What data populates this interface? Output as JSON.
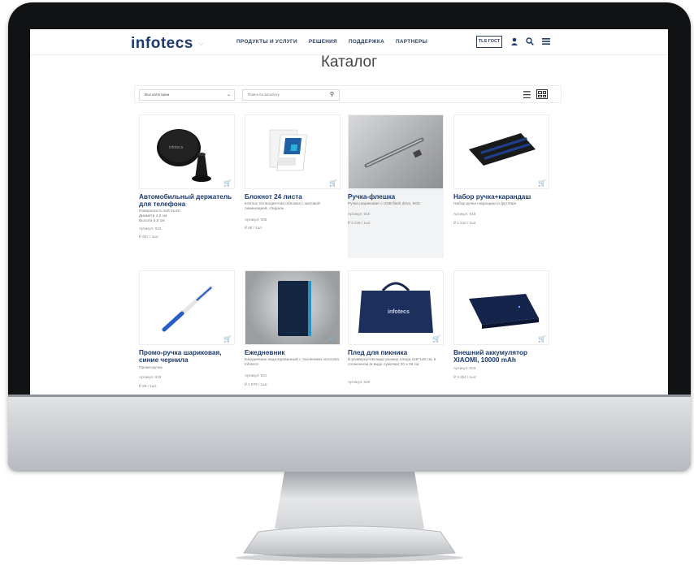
{
  "site": {
    "logo": "infotecs",
    "nav": [
      "ПРОДУКТЫ И УСЛУГИ",
      "РЕШЕНИЯ",
      "ПОДДЕРЖКА",
      "ПАРТНЕРЫ"
    ],
    "tls_badge": "TLS ГОСТ"
  },
  "page_title": "Каталог",
  "filters": {
    "category_value": "Все категории",
    "search_placeholder": "Поиск по каталогу"
  },
  "products": [
    {
      "title": "Автомобильный держатель для телефона",
      "desc": "Поверхность soft touch\nДиаметр 4,2 см\nВысота 5,5 см",
      "sku": "Артикул: 024",
      "price": "₽ 657 / 1шт."
    },
    {
      "title": "Блокнот 24 листа",
      "desc": "Клетка, полноцветная обложка с матовой ламинацией, спираль",
      "sku": "Артикул: 008",
      "price": "₽ 69 / 1шт."
    },
    {
      "title": "Ручка-флешка",
      "desc": "Ручка шариковая с USB-flash drive, 8Gb",
      "sku": "Артикул: 010",
      "price": "₽ 2 249 / 1шт."
    },
    {
      "title": "Набор ручка+карандаш",
      "desc": "Набор ручка+карандаш в футляре",
      "sku": "Артикул: 018",
      "price": "₽ 1 210 / 1шт."
    },
    {
      "title": "Промо-ручка шариковая, синие чернила",
      "desc": "Промо-ручка",
      "sku": "Артикул: 019",
      "price": "₽ 69 / 1шт."
    },
    {
      "title": "Ежедневник",
      "desc": "Ежедневник недатированный с тиснением логотипа Infotecs",
      "sku": "Артикул: 021",
      "price": "₽ 1 978 / 1шт."
    },
    {
      "title": "Плед для пикника",
      "desc": "В развернутом виде размер пледа 119*145 см, в сложенном (в виде сумочки) 30 х 38 см",
      "sku": "Артикул: 020",
      "price": ""
    },
    {
      "title": "Внешний аккумулятор XIAOMI, 10000 mAh",
      "desc": "",
      "sku": "Артикул: 023",
      "price": "₽ 3 354 / 1шт."
    }
  ],
  "colors": {
    "brand": "#1c3a6e",
    "bezel": "#111214"
  }
}
